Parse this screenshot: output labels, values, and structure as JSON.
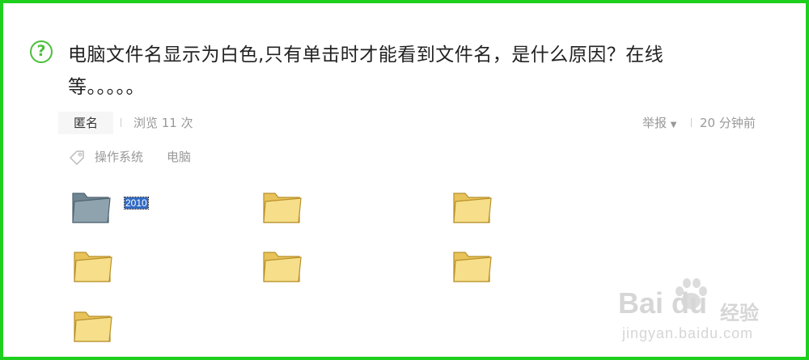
{
  "question": {
    "icon": "question-circle-icon",
    "title_line1": "电脑文件名显示为白色,只有单击时才能看到文件名，是什么原因？在线",
    "title_line2": "等。。。。。"
  },
  "meta": {
    "author": "匿名",
    "views": "浏览 11 次",
    "report": "举报",
    "time": "20 分钟前"
  },
  "tags": [
    "操作系统",
    "电脑"
  ],
  "folders": {
    "selected_name": "2010"
  },
  "watermark": {
    "logo_text": "Bai du",
    "logo_cn": "经验",
    "url": "jingyan.baidu.com"
  },
  "colors": {
    "border": "#1ecf1e",
    "accent_green": "#4bbf3a",
    "selection_blue": "#316ac5",
    "folder_yellow": "#f3d878"
  }
}
